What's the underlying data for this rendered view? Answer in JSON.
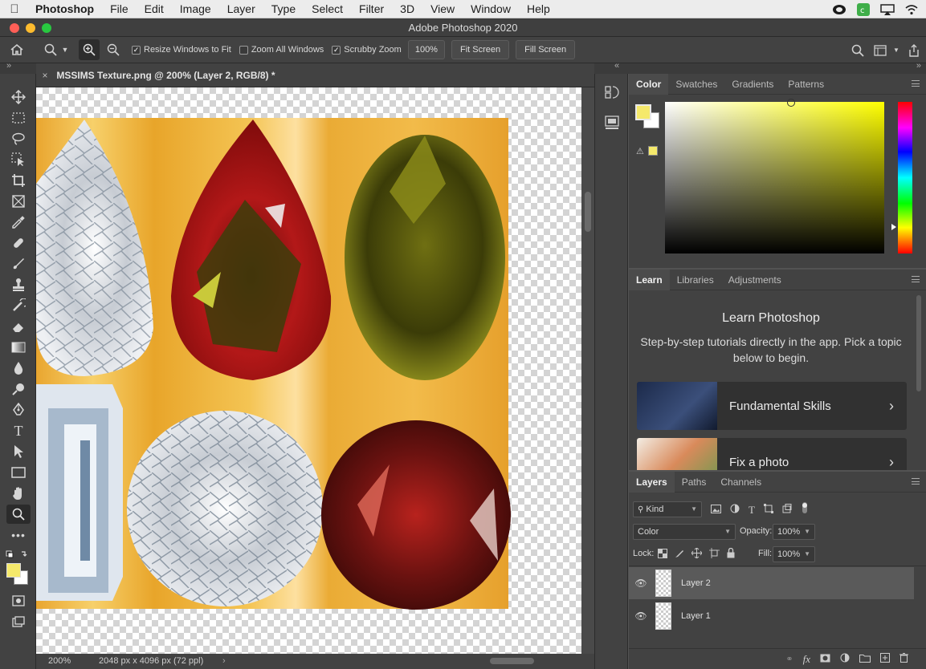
{
  "menubar": {
    "app_name": "Photoshop",
    "items": [
      "File",
      "Edit",
      "Image",
      "Layer",
      "Type",
      "Select",
      "Filter",
      "3D",
      "View",
      "Window",
      "Help"
    ]
  },
  "window": {
    "title": "Adobe Photoshop 2020"
  },
  "options": {
    "resize_windows_label": "Resize Windows to Fit",
    "resize_windows_checked": true,
    "zoom_all_label": "Zoom All Windows",
    "zoom_all_checked": false,
    "scrubby_label": "Scrubby Zoom",
    "scrubby_checked": true,
    "zoom_value": "100%",
    "fit_screen_label": "Fit Screen",
    "fill_screen_label": "Fill Screen"
  },
  "document": {
    "tab_title": "MSSIMS Texture.png @ 200% (Layer 2, RGB/8) *",
    "zoom": "200%",
    "dimensions": "2048 px x 4096 px (72 ppl)"
  },
  "color_panel": {
    "tabs": [
      "Color",
      "Swatches",
      "Gradients",
      "Patterns"
    ],
    "foreground": "#f5e96b",
    "background": "#ffffff",
    "hue_base": "#ffff00"
  },
  "learn_panel": {
    "tabs": [
      "Learn",
      "Libraries",
      "Adjustments"
    ],
    "title": "Learn Photoshop",
    "description": "Step-by-step tutorials directly in the app. Pick a topic below to begin.",
    "items": [
      {
        "label": "Fundamental Skills"
      },
      {
        "label": "Fix a photo"
      }
    ]
  },
  "layers_panel": {
    "tabs": [
      "Layers",
      "Paths",
      "Channels"
    ],
    "filter_kind": "Kind",
    "blend_mode": "Color",
    "opacity_label": "Opacity:",
    "opacity_value": "100%",
    "lock_label": "Lock:",
    "fill_label": "Fill:",
    "fill_value": "100%",
    "layers": [
      {
        "name": "Layer 2",
        "selected": true
      },
      {
        "name": "Layer 1",
        "selected": false
      }
    ]
  }
}
